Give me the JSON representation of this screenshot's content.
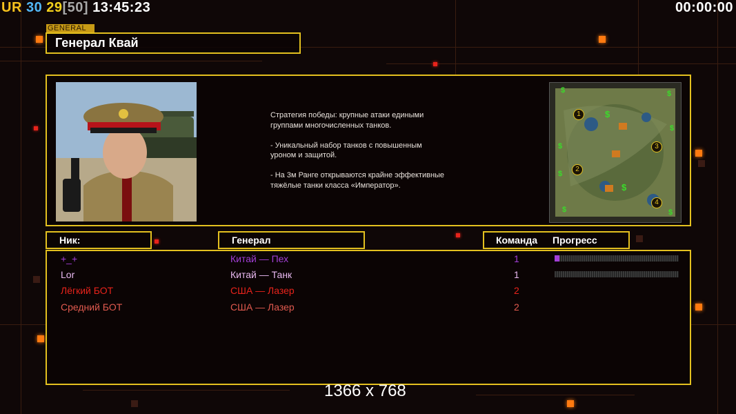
{
  "hud": {
    "ur_label": "UR",
    "num_a": "30",
    "num_b": "29",
    "bracket_num": "[50]",
    "clock": "13:45:23",
    "timer": "00:00:00"
  },
  "general_tag": "GENERAL",
  "general_name": "Генерал Квай",
  "description": "Стратегия победы: крупные атаки едиными\n группами многочисленных танков.\n\n- Уникальный набор танков с повышенным\n уроном и защитой.\n\n- На 3м Ранге открываются крайне эффективные\n тяжёлые танки класса «Император».",
  "minimap": {
    "spawn_numbers": [
      "1",
      "2",
      "3",
      "4"
    ],
    "money_icon": "$"
  },
  "columns": {
    "nick": "Ник:",
    "general": "Генерал",
    "team": "Команда",
    "progress": "Прогресс"
  },
  "players": [
    {
      "nick": "+_+",
      "general": "Китай — Пех",
      "team": "1",
      "color": "#a23fd6",
      "progress": 0.04
    },
    {
      "nick": "Lor",
      "general": "Китай — Танк",
      "team": "1",
      "color": "#e9b9f0",
      "progress": 0.0
    },
    {
      "nick": "Лёгкий БОТ",
      "general": "США — Лазер",
      "team": "2",
      "color": "#e8231b",
      "progress": null
    },
    {
      "nick": "Средний БОТ",
      "general": "США — Лазер",
      "team": "2",
      "color": "#e15a4f",
      "progress": null
    }
  ],
  "resolution_text": "1366 x 768",
  "colors": {
    "accent_border": "#e4c11f",
    "ur_color": "#f7c21d",
    "num_a_color": "#52b7f5",
    "num_b_color": "#f2d01c",
    "bracket_color": "#a9a9a9"
  }
}
